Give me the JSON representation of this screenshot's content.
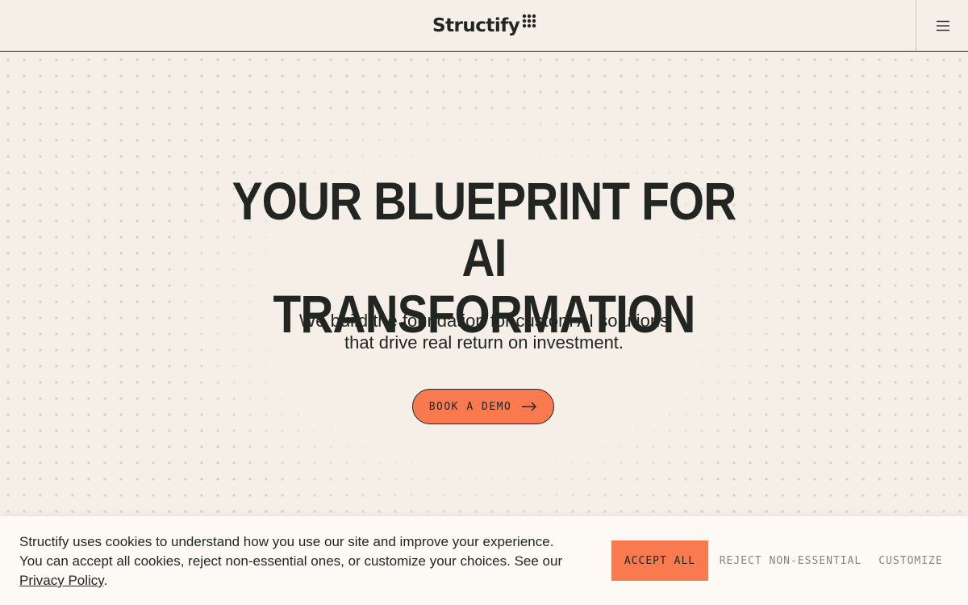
{
  "header": {
    "logo_text": "Structify",
    "menu_icon": "hamburger-menu-icon"
  },
  "hero": {
    "headline_line1": "YOUR BLUEPRINT FOR AI",
    "headline_line2": "TRANSFORMATION",
    "subhead_line1": "We build the foundation for custom AI solutions",
    "subhead_line2": "that drive real return on investment.",
    "cta_label": "BOOK A DEMO",
    "cta_icon": "arrow-right-icon"
  },
  "cookie_banner": {
    "text_line1": "Structify uses cookies to understand how you use our site and improve your experience.",
    "text_line2": "You can accept all cookies, reject non-essential ones, or customize your choices. See our",
    "privacy_link": "Privacy Policy",
    "period": ".",
    "accept_label": "ACCEPT ALL",
    "reject_label": "REJECT NON-ESSENTIAL",
    "customize_label": "CUSTOMIZE"
  },
  "colors": {
    "background": "#f5efe7",
    "accent": "#f87a4e",
    "text": "#222622",
    "muted": "#8a8580"
  }
}
